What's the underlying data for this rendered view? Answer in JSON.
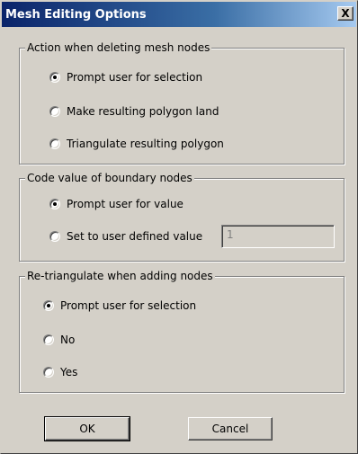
{
  "window": {
    "title": "Mesh Editing Options",
    "close_label": "X"
  },
  "groups": {
    "delete_action": {
      "legend": "Action when deleting mesh nodes",
      "options": [
        {
          "label": "Prompt user for selection",
          "checked": true
        },
        {
          "label": "Make resulting polygon land",
          "checked": false
        },
        {
          "label": "Triangulate resulting polygon",
          "checked": false
        }
      ]
    },
    "boundary_code": {
      "legend": "Code value of boundary nodes",
      "options": [
        {
          "label": "Prompt user for value",
          "checked": true
        },
        {
          "label": "Set to user defined value",
          "checked": false
        }
      ],
      "value_field": "1"
    },
    "retriangulate": {
      "legend": "Re-triangulate when adding nodes",
      "options": [
        {
          "label": "Prompt user for selection",
          "checked": true
        },
        {
          "label": "No",
          "checked": false
        },
        {
          "label": "Yes",
          "checked": false
        }
      ]
    }
  },
  "buttons": {
    "ok": "OK",
    "cancel": "Cancel"
  }
}
